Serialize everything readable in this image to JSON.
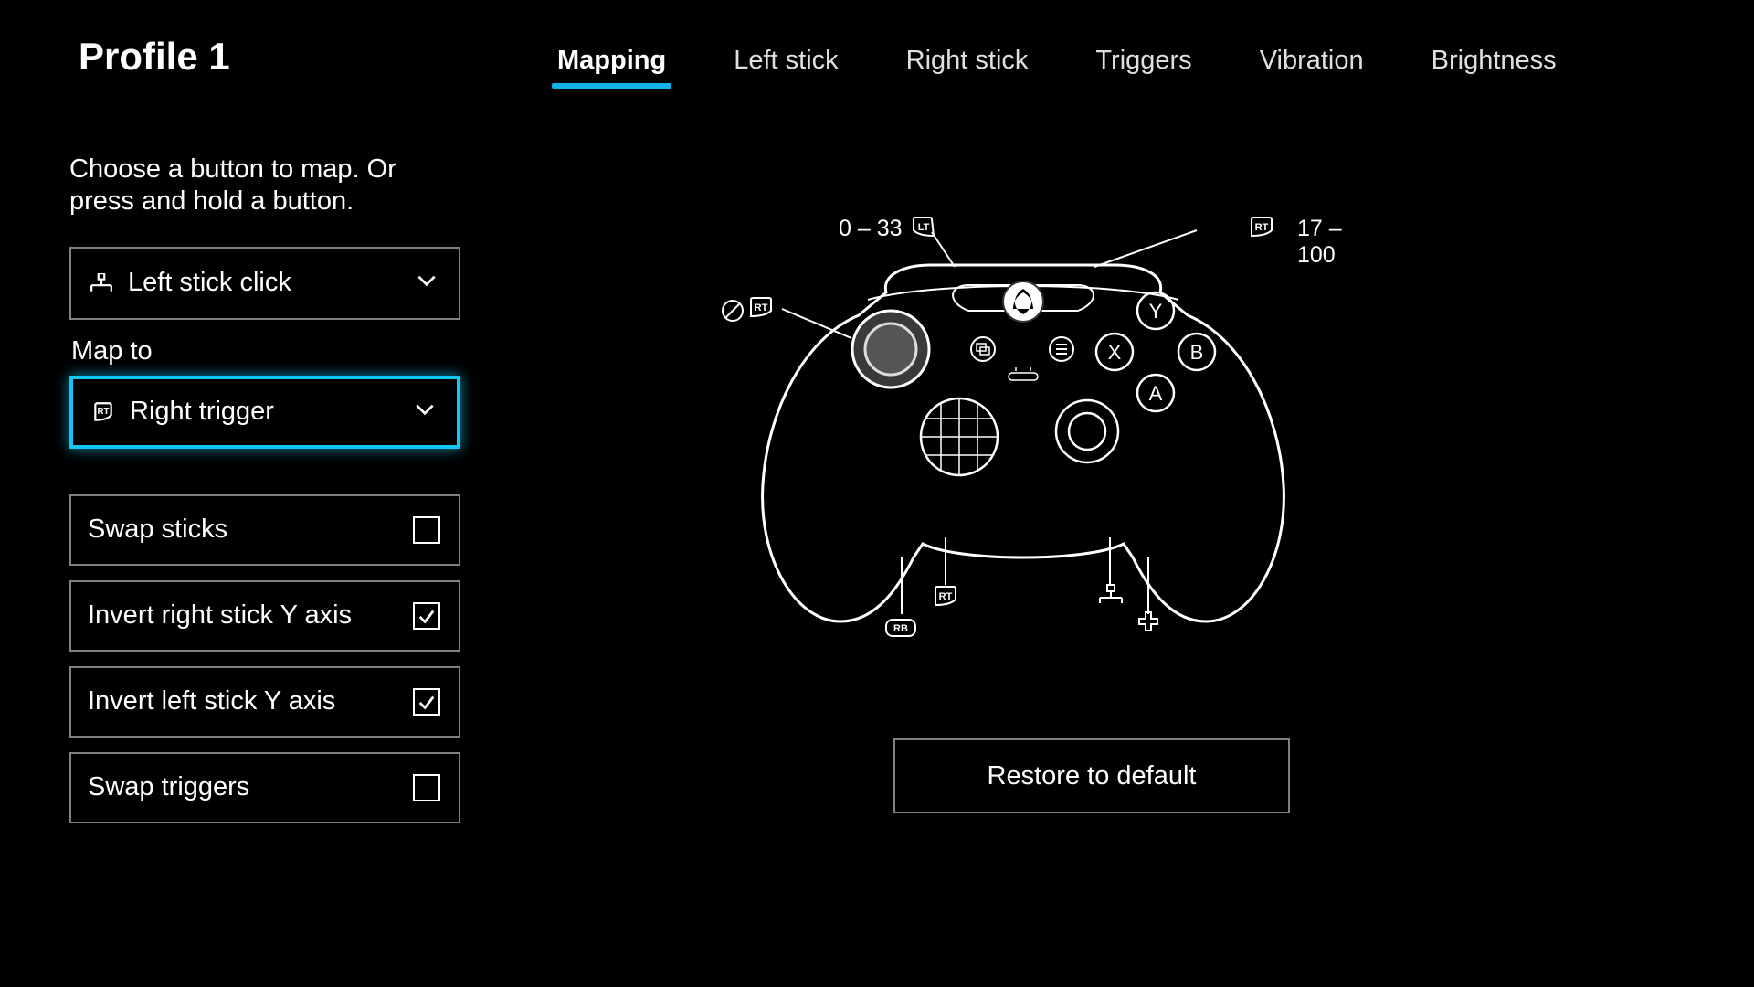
{
  "header": {
    "title": "Profile 1",
    "tabs": [
      {
        "label": "Mapping"
      },
      {
        "label": "Left stick"
      },
      {
        "label": "Right stick"
      },
      {
        "label": "Triggers"
      },
      {
        "label": "Vibration"
      },
      {
        "label": "Brightness"
      }
    ],
    "active_tab_index": 0
  },
  "mapping": {
    "instruction": "Choose a button to map. Or press and hold a button.",
    "source_select": {
      "value": "Left stick click"
    },
    "map_to_label": "Map to",
    "target_select": {
      "value": "Right trigger"
    },
    "checkboxes": [
      {
        "label": "Swap sticks",
        "checked": false
      },
      {
        "label": "Invert right stick Y axis",
        "checked": true
      },
      {
        "label": "Invert left stick Y axis",
        "checked": true
      },
      {
        "label": "Swap triggers",
        "checked": false
      }
    ],
    "restore_label": "Restore to default"
  },
  "diagram": {
    "lt_range": "0 – 33",
    "rt_range": "17 – 100",
    "lt_chip": "LT",
    "rt_chip": "RT",
    "rt_chip2": "RT",
    "rt_chip3": "RT",
    "rb_chip": "RB",
    "buttons": {
      "a": "A",
      "b": "B",
      "x": "X",
      "y": "Y"
    }
  }
}
